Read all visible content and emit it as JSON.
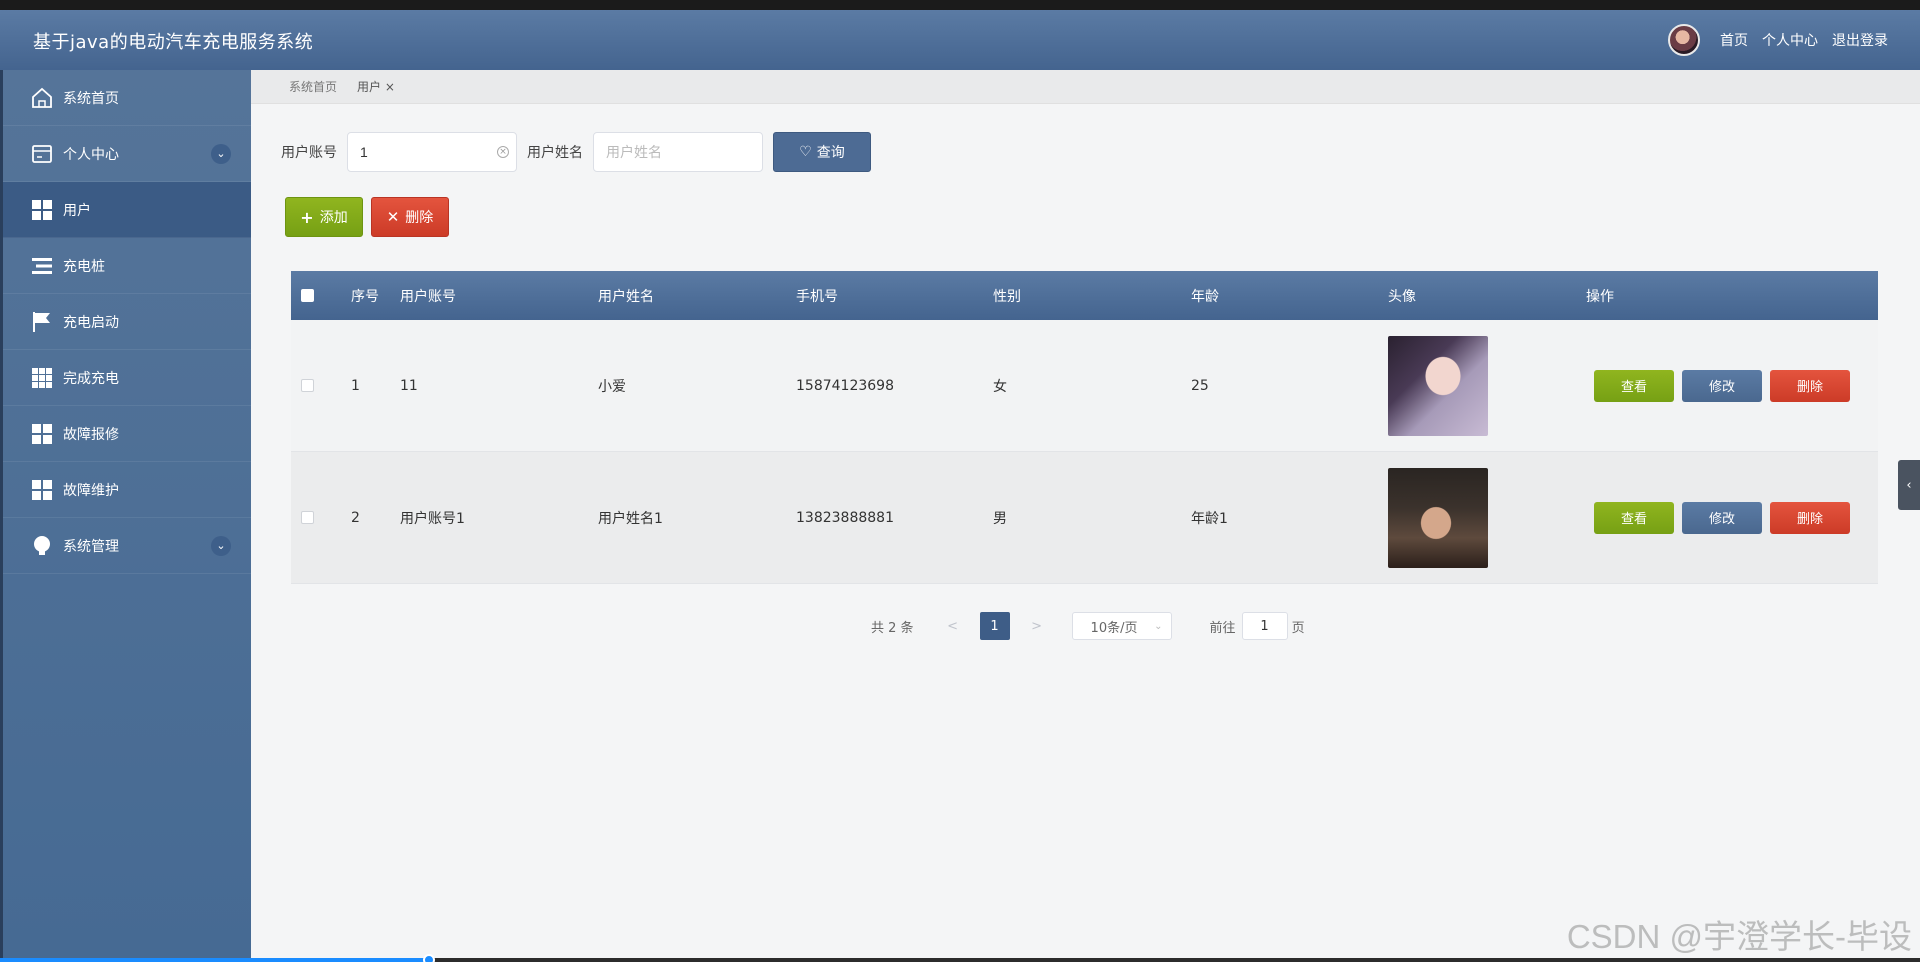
{
  "header": {
    "title": "基于java的电动汽车充电服务系统",
    "nav": [
      "首页",
      "个人中心",
      "退出登录"
    ]
  },
  "sidebar": {
    "items": [
      {
        "label": "系统首页",
        "icon": "home-icon"
      },
      {
        "label": "个人中心",
        "icon": "card-icon",
        "expandable": true
      },
      {
        "label": "用户",
        "icon": "grid-icon",
        "active": true
      },
      {
        "label": "充电桩",
        "icon": "list-icon"
      },
      {
        "label": "充电启动",
        "icon": "flag-icon"
      },
      {
        "label": "完成充电",
        "icon": "grid9-icon"
      },
      {
        "label": "故障报修",
        "icon": "grid-icon"
      },
      {
        "label": "故障维护",
        "icon": "grid-icon"
      },
      {
        "label": "系统管理",
        "icon": "bulb-icon",
        "expandable": true
      }
    ]
  },
  "breadcrumb": {
    "home": "系统首页",
    "current": "用户 ×"
  },
  "search": {
    "account_label": "用户账号",
    "account_value": "1",
    "name_label": "用户姓名",
    "name_placeholder": "用户姓名",
    "query_label": "查询"
  },
  "toolbar": {
    "add_label": "添加",
    "delete_label": "删除"
  },
  "table": {
    "columns": [
      "序号",
      "用户账号",
      "用户姓名",
      "手机号",
      "性别",
      "年龄",
      "头像",
      "操作"
    ],
    "rows": [
      {
        "index": "1",
        "account": "11",
        "name": "小爱",
        "phone": "15874123698",
        "gender": "女",
        "age": "25",
        "photo": "girl-portrait"
      },
      {
        "index": "2",
        "account": "用户账号1",
        "name": "用户姓名1",
        "phone": "13823888881",
        "gender": "男",
        "age": "年龄1",
        "photo": "boy-portrait"
      }
    ],
    "row_actions": {
      "view": "查看",
      "edit": "修改",
      "delete": "删除"
    }
  },
  "pagination": {
    "total": "共 2 条",
    "prev": "<",
    "current": "1",
    "next": ">",
    "page_size": "10条/页",
    "goto_label": "前往",
    "goto_value": "1",
    "page_suffix": "页"
  },
  "side_tab": "‹",
  "watermark": "CSDN @宇澄学长-毕设",
  "colors": {
    "primary": "#4d6b94",
    "success": "#84ab1a",
    "danger": "#d7452f"
  }
}
